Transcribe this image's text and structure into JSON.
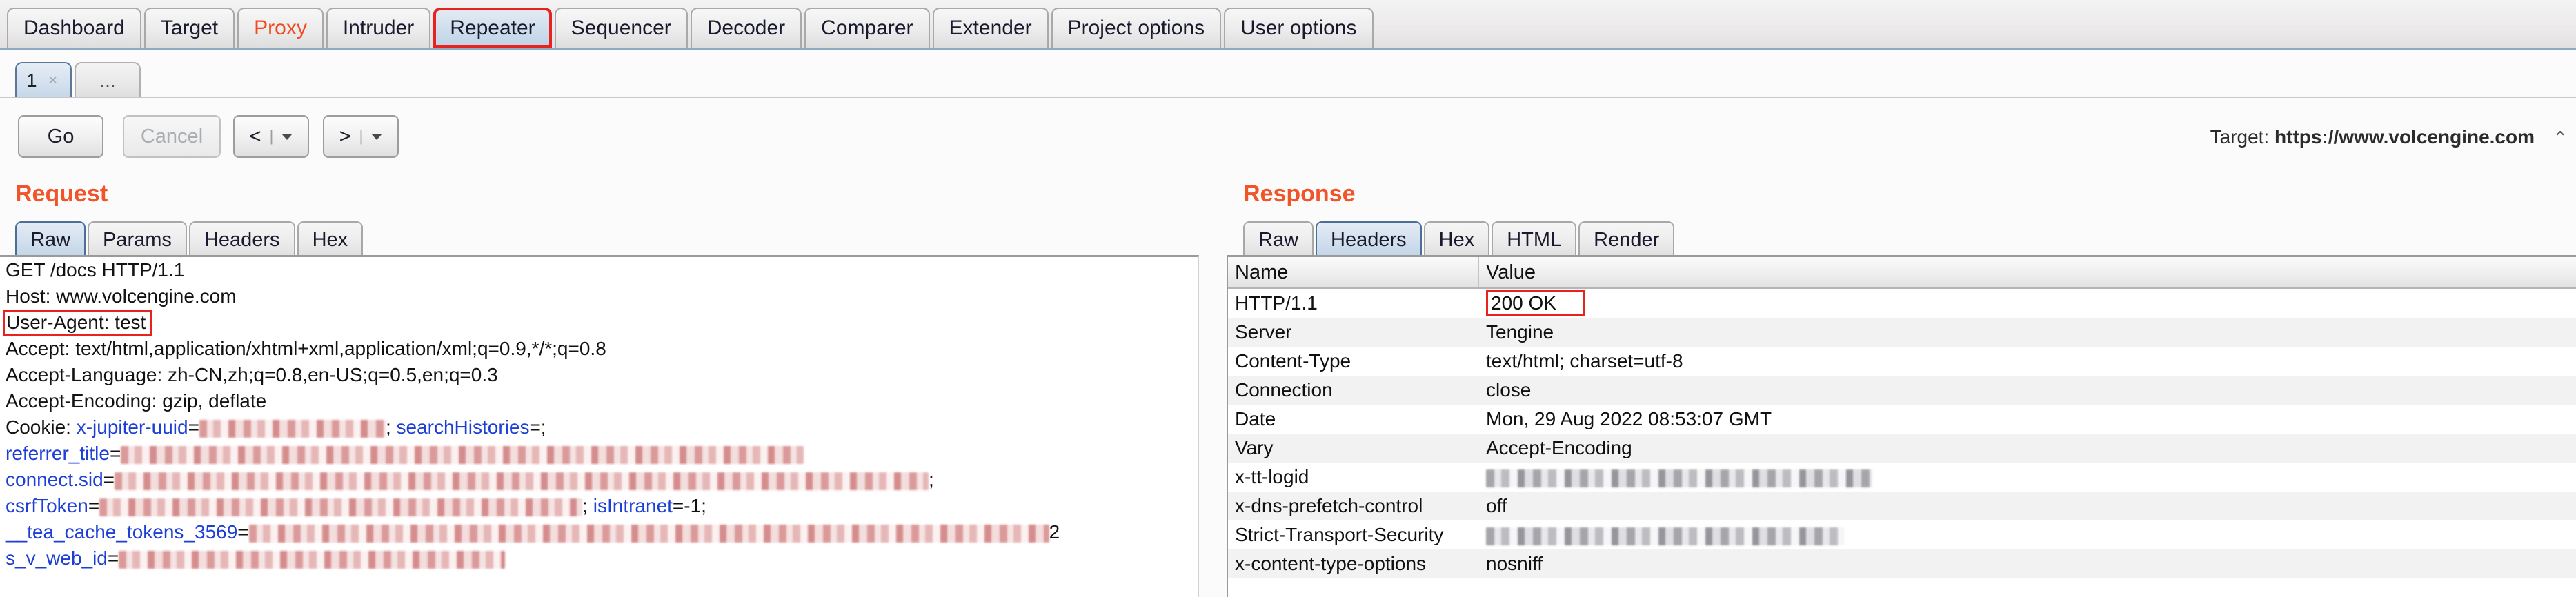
{
  "app": {
    "name": "Burp Suite Repeater"
  },
  "main_tabs": [
    {
      "label": "Dashboard",
      "state": "normal"
    },
    {
      "label": "Target",
      "state": "normal"
    },
    {
      "label": "Proxy",
      "state": "alert"
    },
    {
      "label": "Intruder",
      "state": "normal"
    },
    {
      "label": "Repeater",
      "state": "selected"
    },
    {
      "label": "Sequencer",
      "state": "normal"
    },
    {
      "label": "Decoder",
      "state": "normal"
    },
    {
      "label": "Comparer",
      "state": "normal"
    },
    {
      "label": "Extender",
      "state": "normal"
    },
    {
      "label": "Project options",
      "state": "normal"
    },
    {
      "label": "User options",
      "state": "normal"
    }
  ],
  "sub_tabs": [
    {
      "label": "1",
      "close": "×",
      "selected": true
    },
    {
      "label": "...",
      "selected": false
    }
  ],
  "toolbar": {
    "go_label": "Go",
    "cancel_label": "Cancel",
    "back_label": "<",
    "forward_label": ">",
    "separator": "|",
    "target_prefix": "Target:",
    "target_url": "https://www.volcengine.com",
    "target_chevron": "⌃"
  },
  "request": {
    "title": "Request",
    "tabs": [
      {
        "label": "Raw",
        "selected": true
      },
      {
        "label": "Params",
        "selected": false
      },
      {
        "label": "Headers",
        "selected": false
      },
      {
        "label": "Hex",
        "selected": false
      }
    ],
    "lines": [
      {
        "text": "GET /docs HTTP/1.1",
        "type": "plain"
      },
      {
        "text": "Host: www.volcengine.com",
        "type": "plain"
      },
      {
        "text": "User-Agent: test",
        "type": "highlighted"
      },
      {
        "text": "Accept: text/html,application/xhtml+xml,application/xml;q=0.9,*/*;q=0.8",
        "type": "plain"
      },
      {
        "text": "Accept-Language: zh-CN,zh;q=0.8,en-US;q=0.5,en;q=0.3",
        "type": "plain"
      },
      {
        "text": "Accept-Encoding: gzip, deflate",
        "type": "plain"
      },
      {
        "prefix": "Cookie: ",
        "key": "x-jupiter-uuid",
        "eq": "=",
        "redacted_width": 270,
        "suffix": "; ",
        "key2": "searchHistories",
        "eq2": "=;",
        "type": "cookie"
      },
      {
        "key": "referrer_title",
        "eq": "=",
        "redacted_width": 990,
        "type": "cookie"
      },
      {
        "key": "connect.sid",
        "eq": "=",
        "redacted_width": 1180,
        "suffix": ";",
        "type": "cookie"
      },
      {
        "key": "csrfToken",
        "eq": "=",
        "redacted_width": 700,
        "suffix": "; ",
        "key2": "isIntranet",
        "eq2": "=-1;",
        "type": "cookie"
      },
      {
        "key": "__tea_cache_tokens_3569",
        "eq": "=",
        "redacted_width": 1160,
        "suffix": "2",
        "type": "cookie"
      },
      {
        "key": "s_v_web_id",
        "eq": "=",
        "redacted_width": 560,
        "type": "cookie"
      }
    ],
    "scrollbar": {
      "position": "top"
    }
  },
  "response": {
    "title": "Response",
    "tabs": [
      {
        "label": "Raw",
        "selected": false
      },
      {
        "label": "Headers",
        "selected": true
      },
      {
        "label": "Hex",
        "selected": false
      },
      {
        "label": "HTML",
        "selected": false
      },
      {
        "label": "Render",
        "selected": false
      }
    ],
    "table": {
      "columns": [
        "Name",
        "Value"
      ],
      "rows": [
        {
          "name": "HTTP/1.1",
          "value": "200 OK",
          "highlighted": true
        },
        {
          "name": "Server",
          "value": "Tengine"
        },
        {
          "name": "Content-Type",
          "value": "text/html; charset=utf-8"
        },
        {
          "name": "Connection",
          "value": "close"
        },
        {
          "name": "Date",
          "value": "Mon, 29 Aug 2022 08:53:07 GMT"
        },
        {
          "name": "Vary",
          "value": "Accept-Encoding"
        },
        {
          "name": "x-tt-logid",
          "value": "",
          "redacted_width": 560
        },
        {
          "name": "x-dns-prefetch-control",
          "value": "off"
        },
        {
          "name": "Strict-Transport-Security",
          "value": "",
          "redacted_width": 520
        },
        {
          "name": "x-content-type-options",
          "value": "nosniff"
        }
      ]
    }
  },
  "colors": {
    "accent": "#f0552a",
    "alert": "#f04b20",
    "highlight_box": "#e8231f",
    "tab_selected": "#c3d5e7",
    "link_blue": "#1d3fd6"
  }
}
